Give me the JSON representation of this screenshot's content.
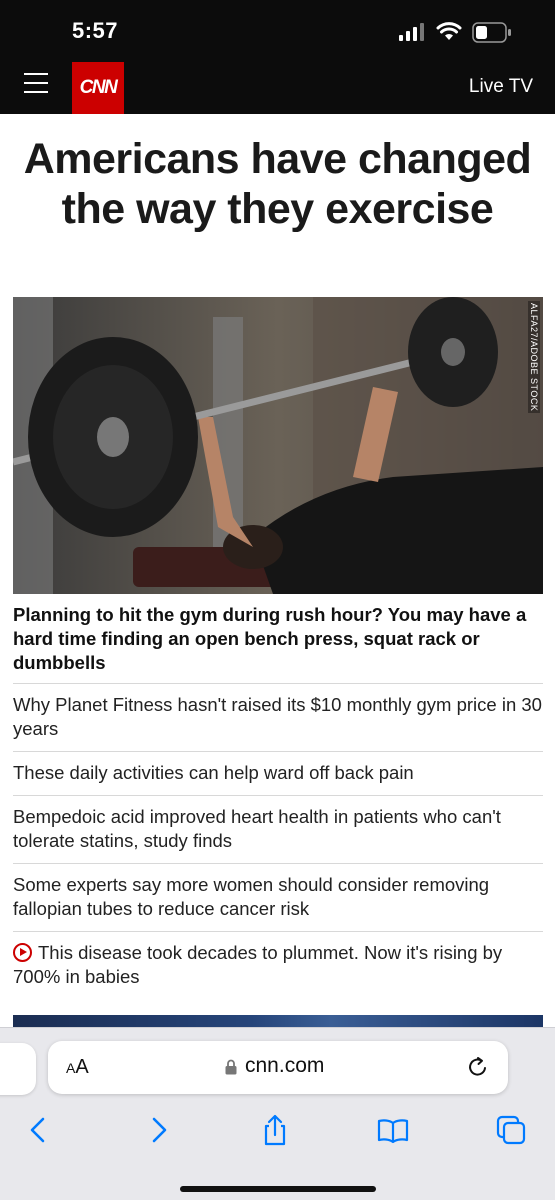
{
  "status_bar": {
    "time": "5:57"
  },
  "header": {
    "logo_text": "CNN",
    "live_tv": "Live TV",
    "background": "#0c0c0c",
    "brand_color": "#cc0000"
  },
  "article": {
    "headline": "Americans have changed the way they exercise",
    "image_credit": "ALFA27/ADOBE STOCK",
    "caption": "Planning to hit the gym during rush hour? You may have a hard time finding an open bench press, squat rack or dumbbells"
  },
  "stories": [
    {
      "text": "Why Planet Fitness hasn't raised its $10 monthly gym price in 30 years",
      "video": false
    },
    {
      "text": "These daily activities can help ward off back pain",
      "video": false
    },
    {
      "text": "Bempedoic acid improved heart health in patients who can't tolerate statins, study finds",
      "video": false
    },
    {
      "text": "Some experts say more women should consider removing fallopian tubes to reduce cancer risk",
      "video": false
    },
    {
      "text": "This disease took decades to plummet. Now it's rising by 700% in babies",
      "video": true
    }
  ],
  "browser": {
    "aa_label_small": "A",
    "aa_label_large": "A",
    "url": "cnn.com",
    "accent": "#007aff",
    "nav_icons": [
      "back-icon",
      "forward-icon",
      "share-icon",
      "bookmarks-icon",
      "tabs-icon"
    ]
  }
}
